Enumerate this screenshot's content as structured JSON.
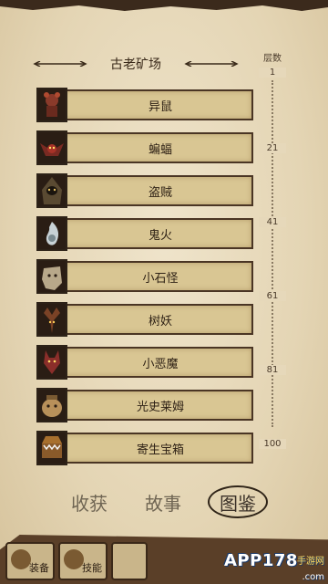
{
  "header": {
    "title": "古老矿场",
    "scale_label": "层数"
  },
  "scale_ticks": [
    "1",
    "21",
    "41",
    "61",
    "81",
    "100"
  ],
  "monsters": [
    {
      "name": "异鼠",
      "icon": "rat-icon"
    },
    {
      "name": "蝙蝠",
      "icon": "bat-icon"
    },
    {
      "name": "盗贼",
      "icon": "thief-icon"
    },
    {
      "name": "鬼火",
      "icon": "ghost-fire-icon"
    },
    {
      "name": "小石怪",
      "icon": "stone-golem-icon"
    },
    {
      "name": "树妖",
      "icon": "tree-demon-icon"
    },
    {
      "name": "小恶魔",
      "icon": "imp-icon"
    },
    {
      "name": "光史莱姆",
      "icon": "light-slime-icon"
    },
    {
      "name": "寄生宝箱",
      "icon": "mimic-chest-icon"
    }
  ],
  "tabs": [
    {
      "label": "收获",
      "active": false
    },
    {
      "label": "故事",
      "active": false
    },
    {
      "label": "图鉴",
      "active": true
    }
  ],
  "bottom_buttons": [
    {
      "label": "装备",
      "icon": "equipment-icon"
    },
    {
      "label": "技能",
      "icon": "skills-icon"
    }
  ],
  "watermark": {
    "text": "APP178",
    "sub": "手游网",
    "url": ".com"
  },
  "colors": {
    "parchment": "#e9dcc0",
    "bar": "#d9c693",
    "border": "#4a3524",
    "dark": "#3b2a1c"
  }
}
